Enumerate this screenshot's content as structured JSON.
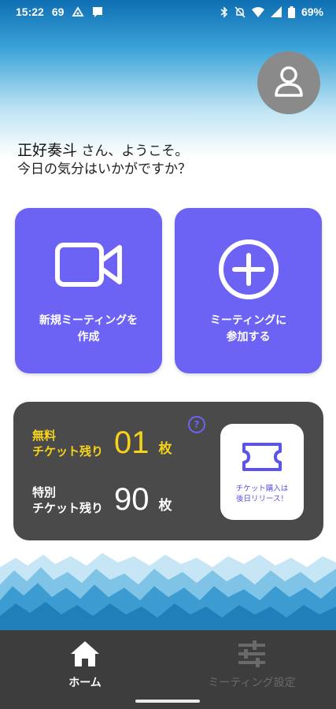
{
  "status_bar": {
    "time": "15:22",
    "extra_number": "69",
    "battery": "69%",
    "icons": [
      "notification-icon",
      "message-icon",
      "bluetooth-icon",
      "mute-icon",
      "wifi-icon",
      "signal-icon",
      "battery-icon"
    ]
  },
  "user": {
    "name": "正好奏斗",
    "greeting_suffix": " さん、ようこそ。",
    "greeting_line2": "今日の気分はいかがですか？"
  },
  "actions": [
    {
      "icon": "video-camera-icon",
      "label_line1": "新規ミーティングを",
      "label_line2": "作成"
    },
    {
      "icon": "plus-circle-icon",
      "label_line1": "ミーティングに",
      "label_line2": "参加する"
    }
  ],
  "tickets": {
    "free": {
      "label_line1": "無料",
      "label_line2": "チケット残り",
      "count": "01",
      "unit": "枚"
    },
    "special": {
      "label_line1": "特別",
      "label_line2": "チケット残り",
      "count": "90",
      "unit": "枚"
    },
    "help_symbol": "?",
    "purchase_note_line1": "チケット購入は",
    "purchase_note_line2": "後日リリース！"
  },
  "nav": {
    "home_label": "ホーム",
    "settings_label": "ミーティング設定",
    "active": "home"
  },
  "colors": {
    "accent": "#6c63f4",
    "free_ticket": "#f7d21b",
    "panel": "#4a4a4a",
    "nav_bg": "#3d3d3d",
    "avatar_bg": "#8a8a8a"
  }
}
